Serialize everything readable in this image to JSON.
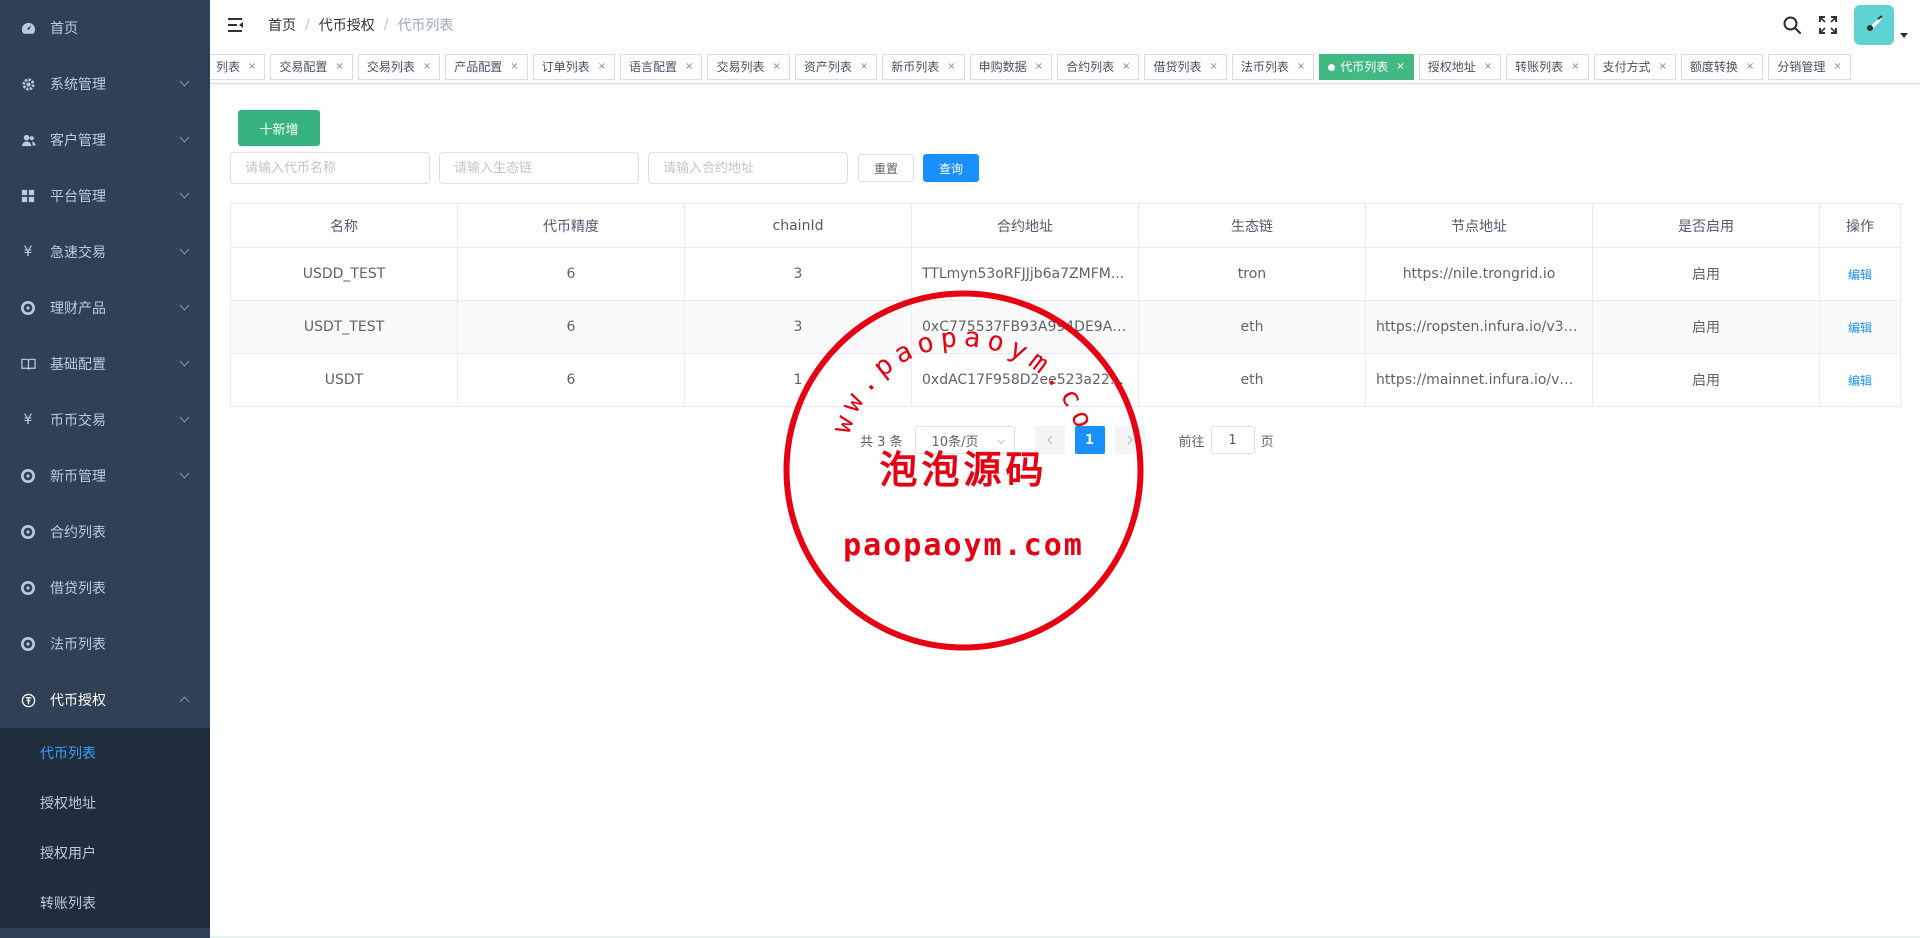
{
  "sidebar": {
    "items": [
      {
        "label": "首页",
        "icon": "dashboard-icon"
      },
      {
        "label": "系统管理",
        "icon": "gear-icon"
      },
      {
        "label": "客户管理",
        "icon": "users-icon"
      },
      {
        "label": "平台管理",
        "icon": "grid-icon"
      },
      {
        "label": "急速交易",
        "icon": "yen-icon"
      },
      {
        "label": "理财产品",
        "icon": "circle-icon"
      },
      {
        "label": "基础配置",
        "icon": "book-icon"
      },
      {
        "label": "币币交易",
        "icon": "yen-icon"
      },
      {
        "label": "新币管理",
        "icon": "circle-icon"
      },
      {
        "label": "合约列表",
        "icon": "circle-icon"
      },
      {
        "label": "借贷列表",
        "icon": "circle-icon"
      },
      {
        "label": "法币列表",
        "icon": "circle-icon"
      },
      {
        "label": "代币授权",
        "icon": "token-icon"
      }
    ],
    "sub_items": [
      {
        "label": "代币列表"
      },
      {
        "label": "授权地址"
      },
      {
        "label": "授权用户"
      },
      {
        "label": "转账列表"
      }
    ]
  },
  "header": {
    "breadcrumb": [
      "首页",
      "代币授权",
      "代币列表"
    ],
    "separator": "/"
  },
  "tags": [
    {
      "label": "列表"
    },
    {
      "label": "交易配置"
    },
    {
      "label": "交易列表"
    },
    {
      "label": "产品配置"
    },
    {
      "label": "订单列表"
    },
    {
      "label": "语言配置"
    },
    {
      "label": "交易列表"
    },
    {
      "label": "资产列表"
    },
    {
      "label": "新币列表"
    },
    {
      "label": "申购数据"
    },
    {
      "label": "合约列表"
    },
    {
      "label": "借贷列表"
    },
    {
      "label": "法币列表"
    },
    {
      "label": "代币列表"
    },
    {
      "label": "授权地址"
    },
    {
      "label": "转账列表"
    },
    {
      "label": "支付方式"
    },
    {
      "label": "额度转换"
    },
    {
      "label": "分销管理"
    }
  ],
  "tag_close": "×",
  "main": {
    "add_button": "十新增",
    "filters": {
      "name_placeholder": "请输入代币名称",
      "chain_placeholder": "请输入生态链",
      "contract_placeholder": "请输入合约地址"
    },
    "reset_button": "重置",
    "search_button": "查询",
    "table": {
      "headers": [
        "名称",
        "代币精度",
        "chainId",
        "合约地址",
        "生态链",
        "节点地址",
        "是否启用",
        "操作"
      ],
      "rows": [
        {
          "name": "USDD_TEST",
          "precision": "6",
          "chainId": "3",
          "contract": "TTLmyn53oRFJJjb6a7ZMFM...",
          "chain": "tron",
          "node": "https://nile.trongrid.io",
          "enabled": "启用",
          "action": "编辑"
        },
        {
          "name": "USDT_TEST",
          "precision": "6",
          "chainId": "3",
          "contract": "0xC775537FB93A994DE9A88...",
          "chain": "eth",
          "node": "https://ropsten.infura.io/v3/8aff...",
          "enabled": "启用",
          "action": "编辑"
        },
        {
          "name": "USDT",
          "precision": "6",
          "chainId": "1",
          "contract": "0xdAC17F958D2ee523a2206...",
          "chain": "eth",
          "node": "https://mainnet.infura.io/v3/8af...",
          "enabled": "启用",
          "action": "编辑"
        }
      ]
    },
    "pagination": {
      "total": "共 3 条",
      "page_size": "10条/页",
      "current_page": "1",
      "goto_label": "前往",
      "goto_value": "1",
      "page_suffix": "页"
    }
  },
  "watermark": {
    "url_text": "www.paopaoym.com",
    "cn_text": "泡泡源码",
    "domain_text": "paopaoym.com",
    "color": "#e60012"
  },
  "colors": {
    "sidebar_bg": "#304156",
    "active_tag": "#42b983",
    "primary": "#1890ff",
    "add_button": "#36b37e"
  }
}
